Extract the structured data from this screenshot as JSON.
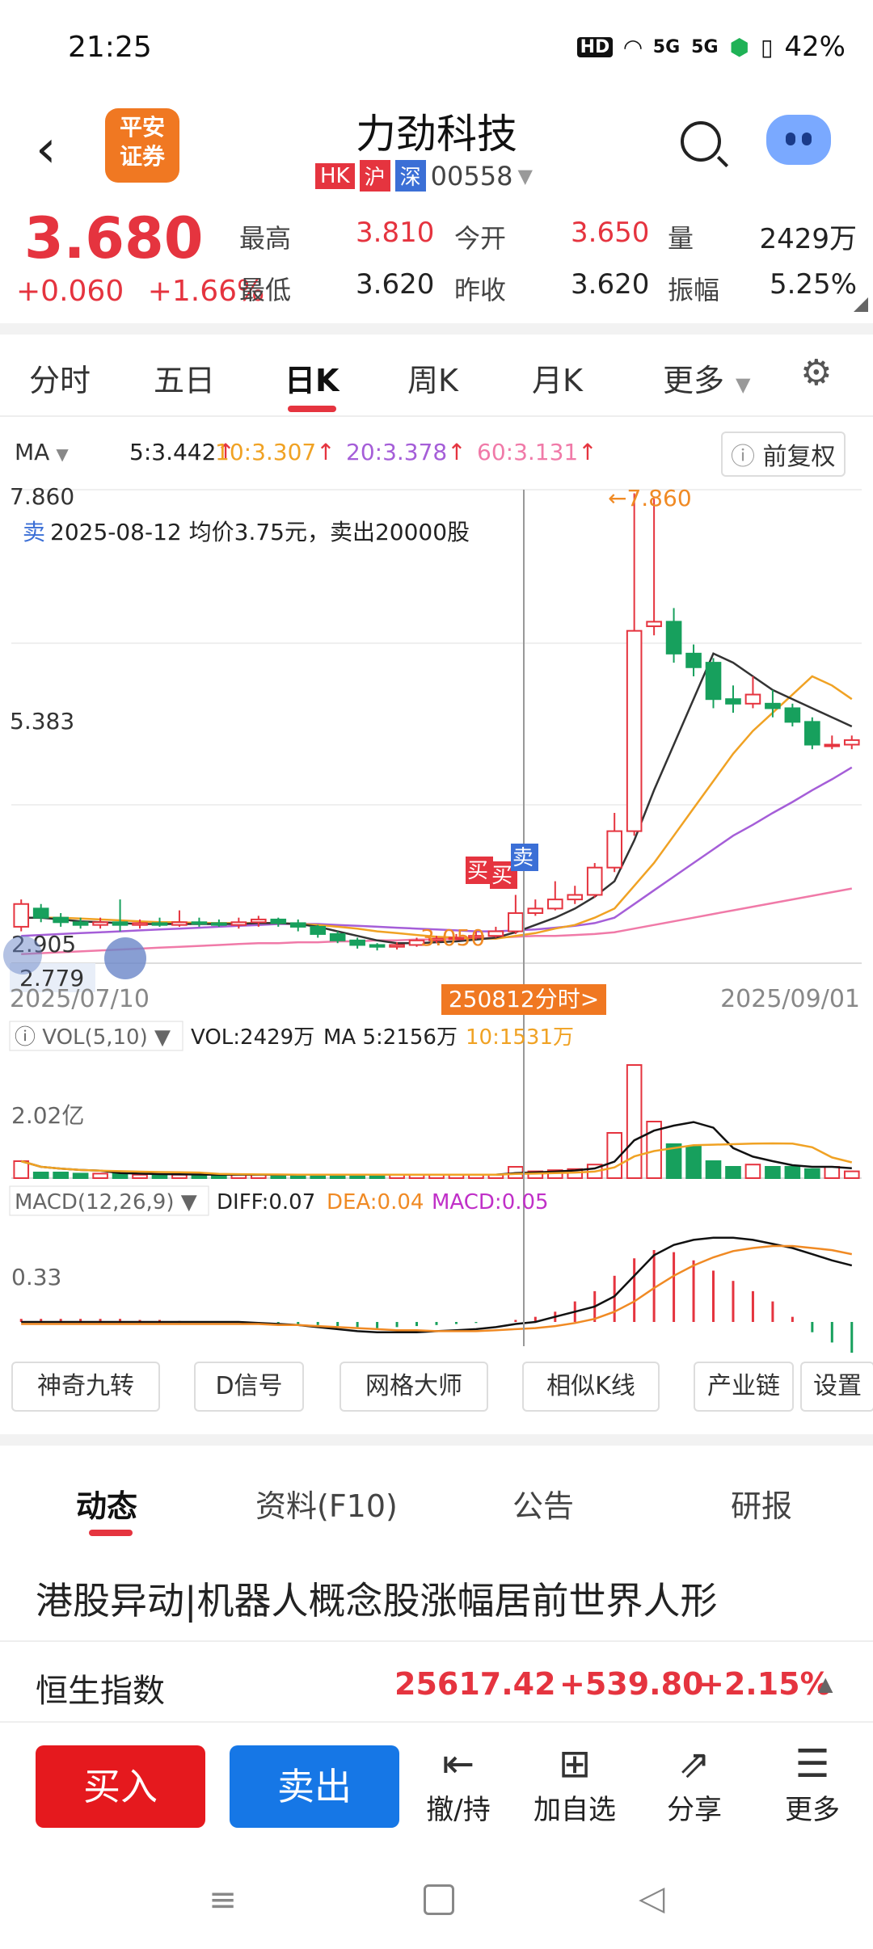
{
  "status": {
    "time": "21:25",
    "battery": "42%",
    "hd": "HD",
    "sig1": "5G",
    "sig2": "5G"
  },
  "header": {
    "logo_text": "平安证券",
    "stock_name": "力劲科技",
    "tags": [
      "HK",
      "沪",
      "深"
    ],
    "code": "00558"
  },
  "quote": {
    "price": "3.680",
    "change": "+0.060",
    "change_pct": "+1.66%",
    "high_label": "最高",
    "high": "3.810",
    "low_label": "最低",
    "low": "3.620",
    "open_label": "今开",
    "open": "3.650",
    "prev_label": "昨收",
    "prev": "3.620",
    "vol_label": "量",
    "vol": "2429万",
    "amp_label": "振幅",
    "amp": "5.25%"
  },
  "ktabs": [
    "分时",
    "五日",
    "日K",
    "周K",
    "月K",
    "更多"
  ],
  "ma_legend": {
    "label": "MA",
    "ma5": "5:3.442",
    "ma10": "10:3.307",
    "ma20": "20:3.378",
    "ma60": "60:3.131",
    "adjust": "前复权"
  },
  "chart_data": {
    "type": "candlestick",
    "x_start": "2025/07/10",
    "x_end": "2025/09/01",
    "y_top_label": "7.860",
    "y_mid_label": "5.383",
    "y_low_label": "2.905",
    "y_min_label": "2.779",
    "high_annotation": "7.860",
    "low_annotation": "3.050",
    "trade_note": "2025-08-12 均价3.75元，卖出20000股",
    "trade_note_tag": "卖",
    "buy_marker": "买",
    "sell_marker": "卖",
    "cursor_label": "250812分时>",
    "candles": [
      [
        3.1,
        3.35,
        3.05,
        3.4
      ],
      [
        3.3,
        3.2,
        3.15,
        3.35
      ],
      [
        3.2,
        3.15,
        3.1,
        3.25
      ],
      [
        3.15,
        3.12,
        3.08,
        3.2
      ],
      [
        3.12,
        3.15,
        3.08,
        3.2
      ],
      [
        3.15,
        3.12,
        3.05,
        3.4
      ],
      [
        3.12,
        3.14,
        3.08,
        3.18
      ],
      [
        3.14,
        3.12,
        3.1,
        3.2
      ],
      [
        3.12,
        3.15,
        3.1,
        3.28
      ],
      [
        3.15,
        3.14,
        3.1,
        3.2
      ],
      [
        3.14,
        3.12,
        3.1,
        3.18
      ],
      [
        3.12,
        3.15,
        3.08,
        3.2
      ],
      [
        3.15,
        3.18,
        3.1,
        3.22
      ],
      [
        3.18,
        3.14,
        3.1,
        3.2
      ],
      [
        3.14,
        3.1,
        3.05,
        3.18
      ],
      [
        3.1,
        3.02,
        2.98,
        3.12
      ],
      [
        3.02,
        2.95,
        2.92,
        3.05
      ],
      [
        2.95,
        2.9,
        2.86,
        2.98
      ],
      [
        2.9,
        2.88,
        2.84,
        2.92
      ],
      [
        2.88,
        2.9,
        2.85,
        2.93
      ],
      [
        2.9,
        2.95,
        2.88,
        2.98
      ],
      [
        2.95,
        2.97,
        2.92,
        3.0
      ],
      [
        2.97,
        2.98,
        2.95,
        3.02
      ],
      [
        2.98,
        3.0,
        2.96,
        3.05
      ],
      [
        3.0,
        3.05,
        2.98,
        3.1
      ],
      [
        3.05,
        3.25,
        3.02,
        3.45
      ],
      [
        3.25,
        3.3,
        3.22,
        3.4
      ],
      [
        3.3,
        3.4,
        3.28,
        3.6
      ],
      [
        3.4,
        3.45,
        3.35,
        3.55
      ],
      [
        3.45,
        3.75,
        3.42,
        3.8
      ],
      [
        3.75,
        4.15,
        3.7,
        4.35
      ],
      [
        4.15,
        6.35,
        4.1,
        7.86
      ],
      [
        6.4,
        6.45,
        6.3,
        7.8
      ],
      [
        6.45,
        6.1,
        6.0,
        6.6
      ],
      [
        6.1,
        5.95,
        5.85,
        6.2
      ],
      [
        6.0,
        5.6,
        5.5,
        6.05
      ],
      [
        5.6,
        5.55,
        5.45,
        5.75
      ],
      [
        5.55,
        5.65,
        5.5,
        5.85
      ],
      [
        5.55,
        5.5,
        5.4,
        5.7
      ],
      [
        5.5,
        5.35,
        5.3,
        5.55
      ],
      [
        5.35,
        5.1,
        5.05,
        5.4
      ],
      [
        5.1,
        5.1,
        5.05,
        5.2
      ],
      [
        5.1,
        5.15,
        5.05,
        5.2
      ]
    ],
    "ma5": [
      3.2,
      3.2,
      3.18,
      3.16,
      3.15,
      3.14,
      3.13,
      3.13,
      3.13,
      3.13,
      3.13,
      3.13,
      3.14,
      3.14,
      3.13,
      3.1,
      3.05,
      3.0,
      2.95,
      2.92,
      2.92,
      2.93,
      2.94,
      2.96,
      2.98,
      3.04,
      3.12,
      3.2,
      3.3,
      3.43,
      3.6,
      4.05,
      4.6,
      5.1,
      5.6,
      6.1,
      6.0,
      5.85,
      5.7,
      5.6,
      5.5,
      5.4,
      5.3
    ],
    "ma10": [
      3.2,
      3.2,
      3.2,
      3.19,
      3.18,
      3.17,
      3.16,
      3.15,
      3.15,
      3.14,
      3.14,
      3.14,
      3.14,
      3.14,
      3.13,
      3.12,
      3.1,
      3.08,
      3.05,
      3.03,
      3.01,
      2.99,
      2.98,
      2.97,
      2.97,
      3.0,
      3.03,
      3.08,
      3.12,
      3.2,
      3.3,
      3.55,
      3.8,
      4.1,
      4.4,
      4.7,
      5.0,
      5.25,
      5.45,
      5.65,
      5.85,
      5.75,
      5.6
    ],
    "ma20": [
      3.0,
      3.01,
      3.02,
      3.03,
      3.04,
      3.05,
      3.06,
      3.07,
      3.08,
      3.09,
      3.1,
      3.11,
      3.12,
      3.13,
      3.13,
      3.13,
      3.12,
      3.11,
      3.1,
      3.09,
      3.08,
      3.07,
      3.06,
      3.05,
      3.05,
      3.06,
      3.07,
      3.09,
      3.11,
      3.14,
      3.2,
      3.35,
      3.5,
      3.65,
      3.8,
      3.95,
      4.1,
      4.22,
      4.35,
      4.47,
      4.6,
      4.72,
      4.85
    ],
    "ma60": [
      2.8,
      2.81,
      2.82,
      2.83,
      2.84,
      2.85,
      2.86,
      2.87,
      2.88,
      2.89,
      2.9,
      2.91,
      2.92,
      2.92,
      2.93,
      2.93,
      2.94,
      2.94,
      2.95,
      2.95,
      2.96,
      2.96,
      2.97,
      2.97,
      2.98,
      2.99,
      3.0,
      3.0,
      3.01,
      3.02,
      3.04,
      3.08,
      3.12,
      3.16,
      3.2,
      3.24,
      3.28,
      3.32,
      3.36,
      3.4,
      3.44,
      3.48,
      3.52
    ],
    "vol_legend": {
      "label": "VOL(5,10)",
      "vol": "VOL:2429万",
      "ma5": "MA 5:2156万",
      "ma10": "10:1531万",
      "y_label": "2.02亿"
    },
    "volumes": [
      0.15,
      0.05,
      0.05,
      0.04,
      0.04,
      0.04,
      0.03,
      0.03,
      0.03,
      0.03,
      0.03,
      0.03,
      0.03,
      0.03,
      0.03,
      0.03,
      0.03,
      0.03,
      0.03,
      0.03,
      0.03,
      0.03,
      0.03,
      0.03,
      0.03,
      0.1,
      0.06,
      0.07,
      0.08,
      0.12,
      0.4,
      1.0,
      0.5,
      0.3,
      0.28,
      0.15,
      0.1,
      0.12,
      0.1,
      0.1,
      0.08,
      0.1,
      0.06
    ],
    "macd_legend": {
      "label": "MACD(12,26,9)",
      "diff": "DIFF:0.07",
      "dea": "DEA:0.04",
      "macd": "MACD:0.05",
      "y_label": "0.33"
    },
    "diff": [
      0.0,
      0.0,
      0.0,
      0.0,
      0.0,
      0.0,
      0.0,
      0.0,
      0.0,
      0.0,
      0.0,
      0.0,
      -0.01,
      -0.02,
      -0.03,
      -0.05,
      -0.07,
      -0.09,
      -0.1,
      -0.1,
      -0.1,
      -0.09,
      -0.08,
      -0.07,
      -0.05,
      -0.02,
      0.0,
      0.05,
      0.1,
      0.15,
      0.25,
      0.45,
      0.65,
      0.75,
      0.8,
      0.82,
      0.82,
      0.8,
      0.76,
      0.72,
      0.66,
      0.6,
      0.55
    ],
    "dea": [
      -0.02,
      -0.02,
      -0.02,
      -0.02,
      -0.02,
      -0.02,
      -0.02,
      -0.02,
      -0.02,
      -0.02,
      -0.02,
      -0.02,
      -0.02,
      -0.03,
      -0.03,
      -0.04,
      -0.05,
      -0.06,
      -0.07,
      -0.08,
      -0.08,
      -0.09,
      -0.09,
      -0.09,
      -0.08,
      -0.07,
      -0.06,
      -0.04,
      -0.01,
      0.03,
      0.1,
      0.2,
      0.33,
      0.45,
      0.55,
      0.63,
      0.69,
      0.72,
      0.74,
      0.74,
      0.72,
      0.7,
      0.66
    ],
    "macd": [
      0.03,
      0.03,
      0.03,
      0.03,
      0.03,
      0.03,
      0.02,
      0.02,
      0.01,
      0.0,
      0.0,
      0.0,
      -0.01,
      -0.01,
      -0.02,
      -0.03,
      -0.04,
      -0.05,
      -0.06,
      -0.05,
      -0.04,
      -0.03,
      -0.02,
      -0.01,
      0.0,
      0.02,
      0.05,
      0.1,
      0.2,
      0.3,
      0.45,
      0.62,
      0.7,
      0.68,
      0.6,
      0.5,
      0.4,
      0.3,
      0.2,
      0.05,
      -0.1,
      -0.2,
      -0.3
    ]
  },
  "tools": [
    "神奇九转",
    "D信号",
    "网格大师",
    "相似K线",
    "产业链",
    "设置"
  ],
  "news_tabs": [
    "动态",
    "资料(F10)",
    "公告",
    "研报"
  ],
  "headline": "港股异动|机器人概念股涨幅居前世界人形",
  "hsi": {
    "name": "恒生指数",
    "value": "25617.42",
    "change": "+539.80",
    "pct": "+2.15%"
  },
  "actions": {
    "buy": "买入",
    "sell": "卖出",
    "hold": "撤/持",
    "watch": "加自选",
    "share": "分享",
    "more": "更多"
  }
}
